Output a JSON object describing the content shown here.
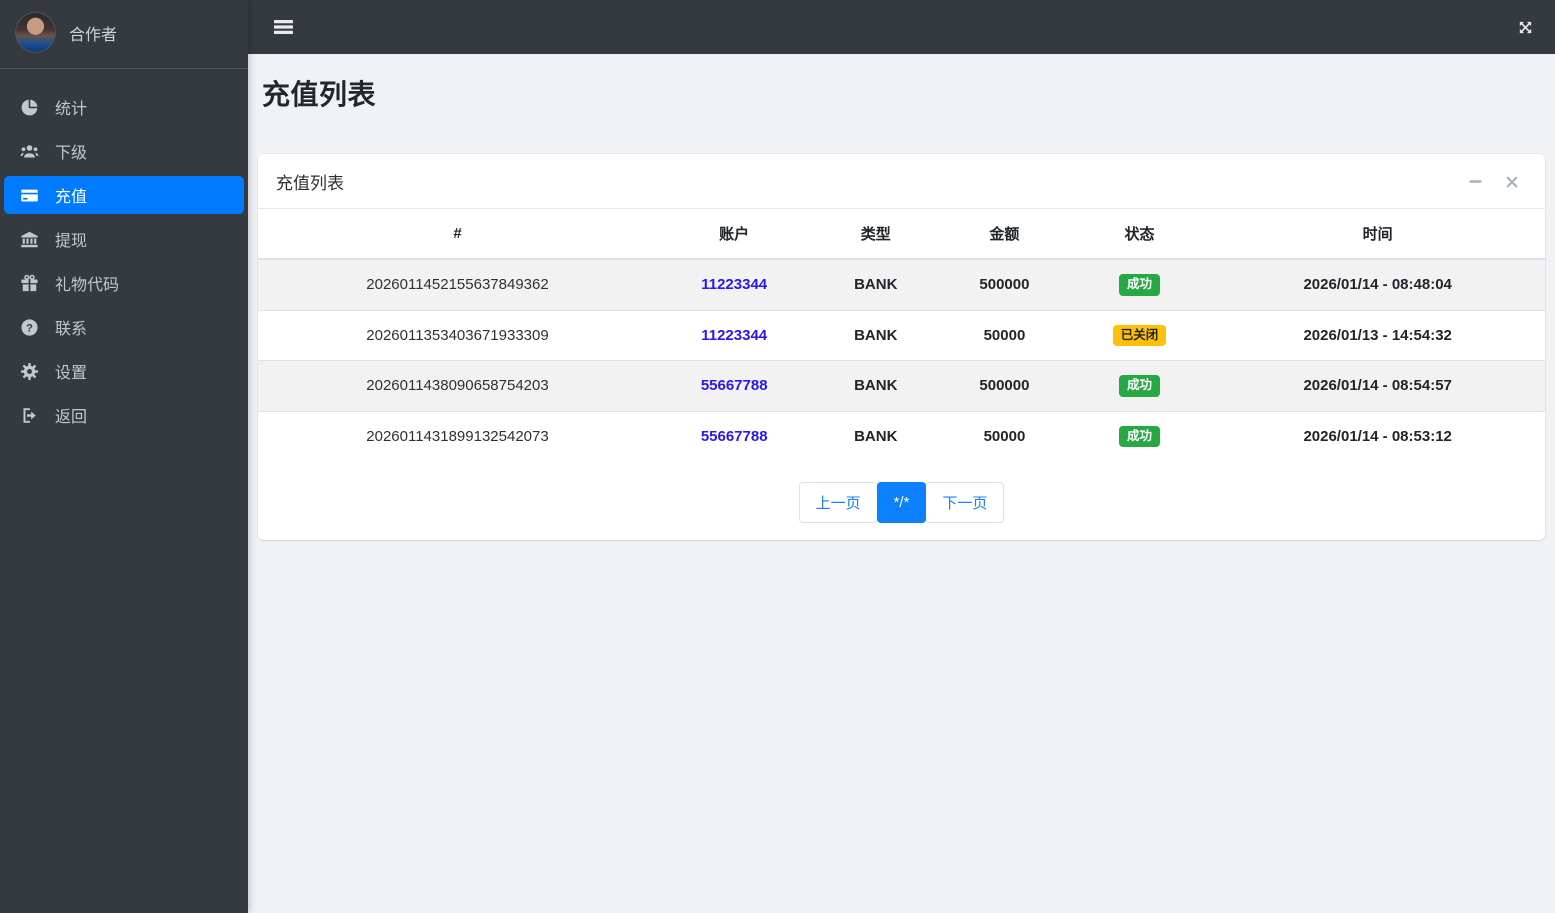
{
  "colors": {
    "accent": "#007bff",
    "success": "#28a745",
    "warning": "#ffc107",
    "link": "#2b16ee",
    "sidebar_bg": "#343a40"
  },
  "sidebar": {
    "user": {
      "name": "合作者"
    },
    "items": [
      {
        "label": "统计",
        "icon": "pie-chart-icon",
        "active": false
      },
      {
        "label": "下级",
        "icon": "users-icon",
        "active": false
      },
      {
        "label": "充值",
        "icon": "credit-card-icon",
        "active": true
      },
      {
        "label": "提现",
        "icon": "bank-icon",
        "active": false
      },
      {
        "label": "礼物代码",
        "icon": "gift-icon",
        "active": false
      },
      {
        "label": "联系",
        "icon": "question-circle-icon",
        "active": false
      },
      {
        "label": "设置",
        "icon": "gear-icon",
        "active": false
      },
      {
        "label": "返回",
        "icon": "sign-out-icon",
        "active": false
      }
    ]
  },
  "topbar": {
    "menu_icon": "hamburger-icon",
    "fullscreen_icon": "expand-arrows-icon"
  },
  "page": {
    "title": "充值列表"
  },
  "card": {
    "title": "充值列表"
  },
  "table": {
    "headers": [
      "#",
      "账户",
      "类型",
      "金额",
      "状态",
      "时间"
    ],
    "rows": [
      {
        "id": "2026011452155637849362",
        "account": "11223344",
        "type": "BANK",
        "amount": "500000",
        "status": {
          "label": "成功",
          "type": "success"
        },
        "time": "2026/01/14 - 08:48:04"
      },
      {
        "id": "2026011353403671933309",
        "account": "11223344",
        "type": "BANK",
        "amount": "50000",
        "status": {
          "label": "已关闭",
          "type": "warning"
        },
        "time": "2026/01/13 - 14:54:32"
      },
      {
        "id": "2026011438090658754203",
        "account": "55667788",
        "type": "BANK",
        "amount": "500000",
        "status": {
          "label": "成功",
          "type": "success"
        },
        "time": "2026/01/14 - 08:54:57"
      },
      {
        "id": "2026011431899132542073",
        "account": "55667788",
        "type": "BANK",
        "amount": "50000",
        "status": {
          "label": "成功",
          "type": "success"
        },
        "time": "2026/01/14 - 08:53:12"
      }
    ]
  },
  "pagination": {
    "prev": "上一页",
    "current": "*/*",
    "next": "下一页"
  }
}
